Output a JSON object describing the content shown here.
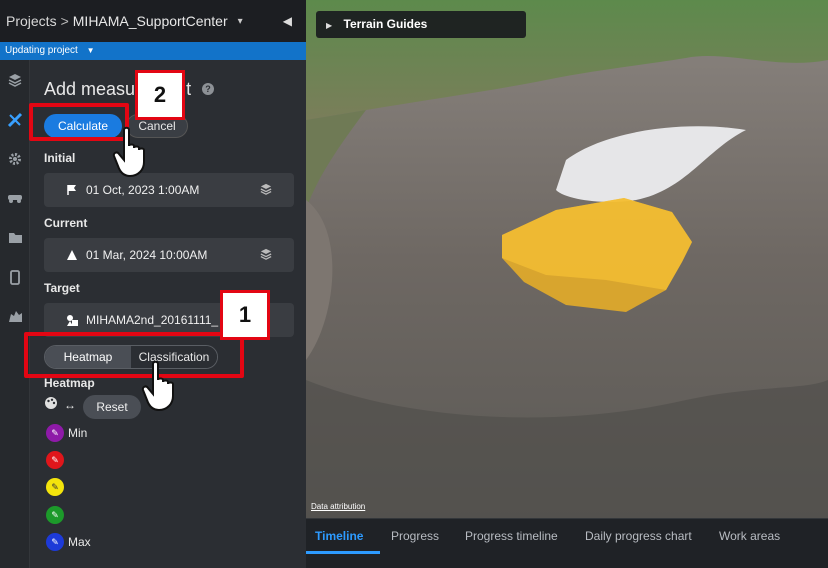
{
  "header": {
    "breadcrumb_root": "Projects",
    "separator": ">",
    "project_name": "MIHAMA_SupportCenter"
  },
  "status": {
    "text": "Updating project"
  },
  "panel": {
    "title": "Add measurement",
    "calculate_label": "Calculate",
    "cancel_label": "Cancel",
    "initial": {
      "label": "Initial",
      "value": "01 Oct, 2023 1:00AM",
      "icon": "flag-icon"
    },
    "current": {
      "label": "Current",
      "value": "01 Mar, 2024 10:00AM",
      "icon": "triangle-icon"
    },
    "target": {
      "label": "Target",
      "value": "MIHAMA2nd_20161111_",
      "icon": "shapes-icon"
    },
    "view_modes": {
      "heatmap": "Heatmap",
      "classification": "Classification"
    },
    "heatmap": {
      "label": "Heatmap",
      "reset_label": "Reset",
      "legend": [
        {
          "label": "Min",
          "color": "#8e1aa8"
        },
        {
          "label": "",
          "color": "#e0161b"
        },
        {
          "label": "",
          "color": "#f4e40c"
        },
        {
          "label": "",
          "color": "#1c9a2a"
        },
        {
          "label": "Max",
          "color": "#1d3ad8"
        }
      ]
    }
  },
  "viewport": {
    "terrain_guides_label": "Terrain Guides",
    "attribution": "Data attribution"
  },
  "bottom_tabs": [
    "Timeline",
    "Progress",
    "Progress timeline",
    "Daily progress chart",
    "Work areas"
  ],
  "annotations": {
    "step1": "1",
    "step2": "2"
  },
  "colors": {
    "accent": "#1a7be0",
    "callout": "#e30613",
    "volume": "#f0b323"
  }
}
